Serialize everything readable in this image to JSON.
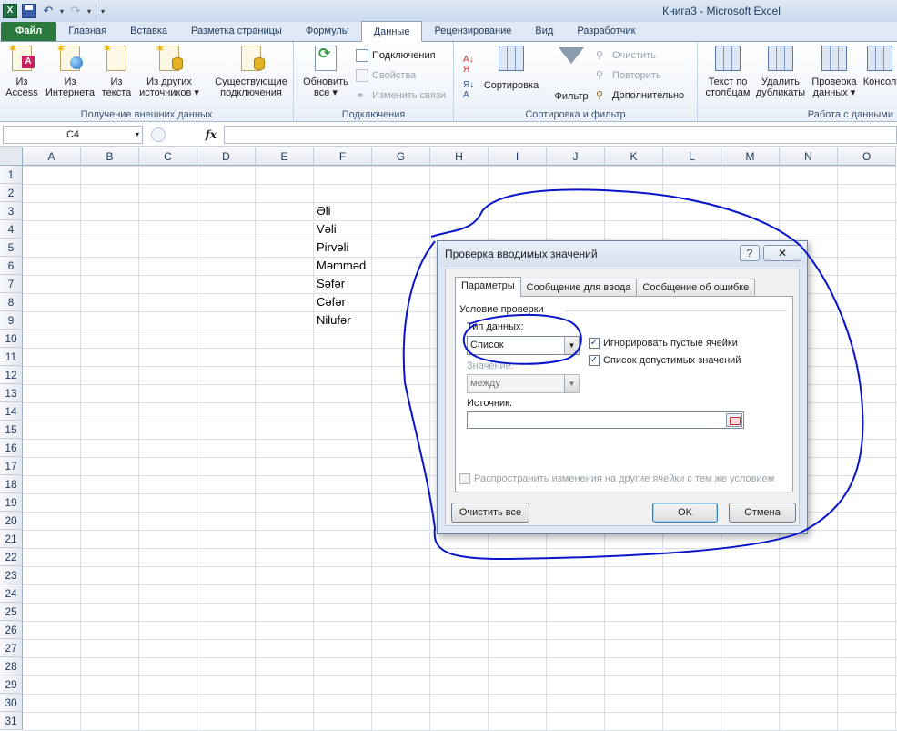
{
  "window": {
    "title": "Книга3 - Microsoft Excel",
    "qat_icon": "excel-icon"
  },
  "tabs": [
    {
      "label": "Файл"
    },
    {
      "label": "Главная"
    },
    {
      "label": "Вставка"
    },
    {
      "label": "Разметка страницы"
    },
    {
      "label": "Формулы"
    },
    {
      "label": "Данные"
    },
    {
      "label": "Рецензирование"
    },
    {
      "label": "Вид"
    },
    {
      "label": "Разработчик"
    }
  ],
  "ribbon": {
    "get_external": {
      "label": "Получение внешних данных",
      "access_l1": "Из",
      "access_l2": "Access",
      "web_l1": "Из",
      "web_l2": "Интернета",
      "text_l1": "Из",
      "text_l2": "текста",
      "other_l1": "Из других",
      "other_l2": "источников ▾",
      "existing_l1": "Существующие",
      "existing_l2": "подключения"
    },
    "connections": {
      "label": "Подключения",
      "refresh_l1": "Обновить",
      "refresh_l2": "все ▾",
      "connections": "Подключения",
      "properties": "Свойства",
      "edit_links": "Изменить связи"
    },
    "sort_filter": {
      "label": "Сортировка и фильтр",
      "sort": "Сортировка",
      "filter": "Фильтр",
      "clear": "Очистить",
      "reapply": "Повторить",
      "advanced": "Дополнительно"
    },
    "data_tools": {
      "label": "Работа с данными",
      "text_cols_l1": "Текст по",
      "text_cols_l2": "столбцам",
      "remove_dup_l1": "Удалить",
      "remove_dup_l2": "дубликаты",
      "validation_l1": "Проверка",
      "validation_l2": "данных ▾",
      "consolidate": "Консол"
    }
  },
  "formula_bar": {
    "name_box": "C4",
    "fx": "fx",
    "value": ""
  },
  "sheet": {
    "columns": [
      "A",
      "B",
      "C",
      "D",
      "E",
      "F",
      "G",
      "H",
      "I",
      "J",
      "K",
      "L",
      "M",
      "N",
      "O"
    ],
    "rows": [
      "1",
      "2",
      "3",
      "4",
      "5",
      "6",
      "7",
      "8",
      "9",
      "10",
      "11",
      "12",
      "13",
      "14",
      "15",
      "16",
      "17",
      "18",
      "19",
      "20",
      "21",
      "22",
      "23",
      "24",
      "25",
      "26",
      "27",
      "28",
      "29",
      "30",
      "31"
    ],
    "f_values": [
      "Əli",
      "Vəli",
      "Pirvəli",
      "Məmməd",
      "Səfər",
      "Cəfər",
      "Nilufər"
    ]
  },
  "dialog": {
    "title": "Проверка вводимых значений",
    "help": "?",
    "close": "✕",
    "tabs": [
      "Параметры",
      "Сообщение для ввода",
      "Сообщение об ошибке"
    ],
    "section": "Условие проверки",
    "type_label": "Тип данных:",
    "type_value": "Список",
    "value_label": "Значение:",
    "value_value": "между",
    "ignore_blank": "Игнорировать пустые ячейки",
    "in_cell_dropdown": "Список допустимых значений",
    "source_label": "Источник:",
    "source_value": "",
    "apply_all": "Распространить изменения на другие ячейки с тем же условием",
    "clear_all": "Очистить все",
    "ok": "OK",
    "cancel": "Отмена"
  },
  "colors": {
    "annotation": "#0a14c8",
    "file_tab": "#2a7a3e"
  }
}
